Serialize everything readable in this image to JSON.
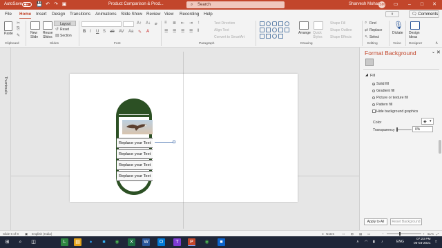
{
  "titlebar": {
    "autosave_label": "AutoSave",
    "autosave_state": "Off",
    "document_title": "Product Comparison & Prod...",
    "search_placeholder": "Search",
    "user_name": "Sharvesh Mohan",
    "user_initials": "SM"
  },
  "tabs": [
    "File",
    "Home",
    "Insert",
    "Design",
    "Transitions",
    "Animations",
    "Slide Show",
    "Review",
    "View",
    "Recording",
    "Help"
  ],
  "active_tab": "Home",
  "share_label": "Share",
  "comments_label": "Comments",
  "ribbon": {
    "clipboard": {
      "paste": "Paste",
      "group": "Clipboard"
    },
    "slides": {
      "new_slide": "New\nSlide",
      "reuse": "Reuse\nSlides",
      "layout": "Layout",
      "reset": "Reset",
      "section": "Section",
      "group": "Slides"
    },
    "font": {
      "group": "Font"
    },
    "paragraph": {
      "text_direction": "Text Direction",
      "align_text": "Align Text",
      "smartart": "Convert to SmartArt",
      "group": "Paragraph"
    },
    "drawing": {
      "arrange": "Arrange",
      "quick_styles": "Quick\nStyles",
      "shape_fill": "Shape Fill",
      "shape_outline": "Shape Outline",
      "shape_effects": "Shape Effects",
      "group": "Drawing"
    },
    "editing": {
      "find": "Find",
      "replace": "Replace",
      "select": "Select",
      "group": "Editing"
    },
    "voice": {
      "dictate": "Dictate",
      "group": "Voice"
    },
    "designer": {
      "design_ideas": "Design\nIdeas",
      "group": "Designer"
    }
  },
  "thumbnails_label": "Thumbnails",
  "slide": {
    "rows": [
      "Replace your Text",
      "Replace your Text",
      "Replace your Text",
      "Replace your Text"
    ]
  },
  "pane": {
    "title": "Format Background",
    "section": "Fill",
    "options": [
      "Solid fill",
      "Gradient fill",
      "Picture or texture fill",
      "Pattern fill"
    ],
    "selected_option": "Solid fill",
    "hide_graphics": "Hide background graphics",
    "color_label": "Color",
    "transparency_label": "Transparency",
    "transparency_value": "0%",
    "apply_all": "Apply to All",
    "reset_bg": "Reset Background"
  },
  "statusbar": {
    "slide_info": "Slide 6 of 8",
    "language": "English (India)",
    "notes": "Notes",
    "zoom": "61%"
  },
  "taskbar": {
    "lang": "ENG",
    "time": "07:23 PM",
    "date": "06-03-2021"
  },
  "colors": {
    "accent": "#c2462b",
    "pill_green": "#2c5024",
    "taskbar": "#1f2638"
  }
}
